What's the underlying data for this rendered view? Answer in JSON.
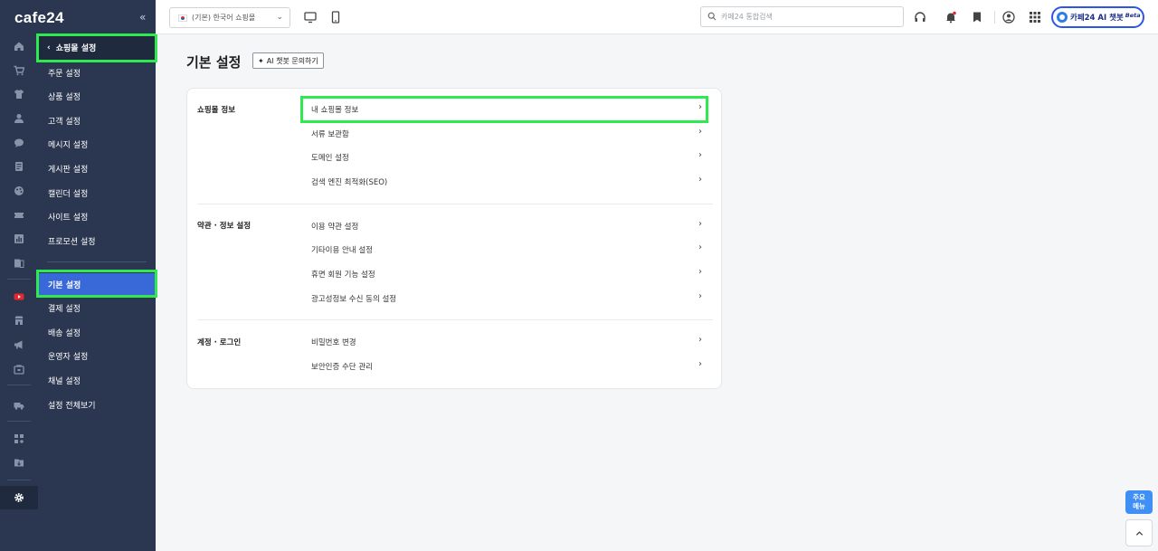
{
  "brand": {
    "logo_text": "cafe24",
    "collapse_glyph": "«"
  },
  "rail": {
    "icons": [
      "home-icon",
      "cart-icon",
      "shirt-icon",
      "user-icon",
      "chat-icon",
      "board-icon",
      "palette-icon",
      "ticket-icon",
      "chart-icon",
      "report-icon",
      "youtube-icon",
      "store-icon",
      "megaphone-icon",
      "shop-icon",
      "truck-icon",
      "apps-icon",
      "folder-icon",
      "gear-icon"
    ]
  },
  "sidebar": {
    "header": "쇼핑몰 설정",
    "group1": [
      "주문 설정",
      "상품 설정",
      "고객 설정",
      "메시지 설정",
      "게시판 설정",
      "캘린더 설정",
      "사이트 설정",
      "프로모션 설정"
    ],
    "group2": [
      "기본 설정",
      "결제 설정",
      "배송 설정",
      "운영자 설정",
      "채널 설정",
      "설정 전체보기"
    ],
    "active": "기본 설정"
  },
  "topbar": {
    "mall_select": "(기본) 한국어 쇼핑몰",
    "search_placeholder": "카페24 통합검색",
    "ai_button": "카페24 AI 챗봇",
    "ai_badge": "Beta"
  },
  "main": {
    "title": "기본 설정",
    "chatbot_button": "AI 챗봇 문의하기",
    "sections": [
      {
        "label": "쇼핑몰 정보",
        "items": [
          "내 쇼핑몰 정보",
          "서류 보관함",
          "도메인 설정",
          "검색 엔진 최적화(SEO)"
        ]
      },
      {
        "label": "약관 · 정보 설정",
        "items": [
          "이용 약관 설정",
          "기타이용 안내 설정",
          "휴면 회원 기능 설정",
          "광고성정보 수신 동의 설정"
        ]
      },
      {
        "label": "계정 · 로그인",
        "items": [
          "비밀번호 변경",
          "보안인증 수단 관리"
        ]
      }
    ]
  },
  "floating": {
    "menu_line1": "주요",
    "menu_line2": "메뉴"
  }
}
